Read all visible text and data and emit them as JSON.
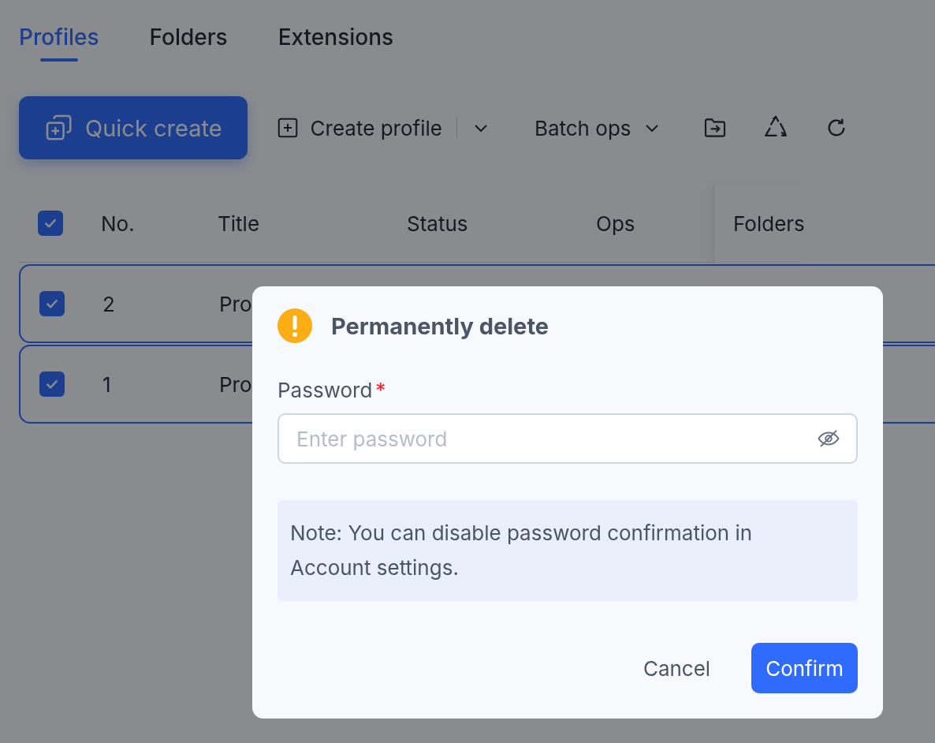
{
  "tabs": [
    {
      "label": "Profiles",
      "selected": true
    },
    {
      "label": "Folders",
      "selected": false
    },
    {
      "label": "Extensions",
      "selected": false
    }
  ],
  "toolbar": {
    "quick_create": "Quick create",
    "create_profile": "Create profile",
    "batch_ops": "Batch ops"
  },
  "table": {
    "select_all_checked": true,
    "columns": [
      "No.",
      "Title",
      "Status",
      "Ops",
      "Folders"
    ],
    "rows": [
      {
        "checked": true,
        "no": "2",
        "title": "Pro"
      },
      {
        "checked": true,
        "no": "1",
        "title": "Pro"
      }
    ]
  },
  "dialog": {
    "title": "Permanently delete",
    "field_label": "Password",
    "required_mark": "*",
    "placeholder": "Enter password",
    "note": "Note: You can disable password confirmation in Account settings.",
    "buttons": [
      "Cancel",
      "Confirm"
    ]
  }
}
